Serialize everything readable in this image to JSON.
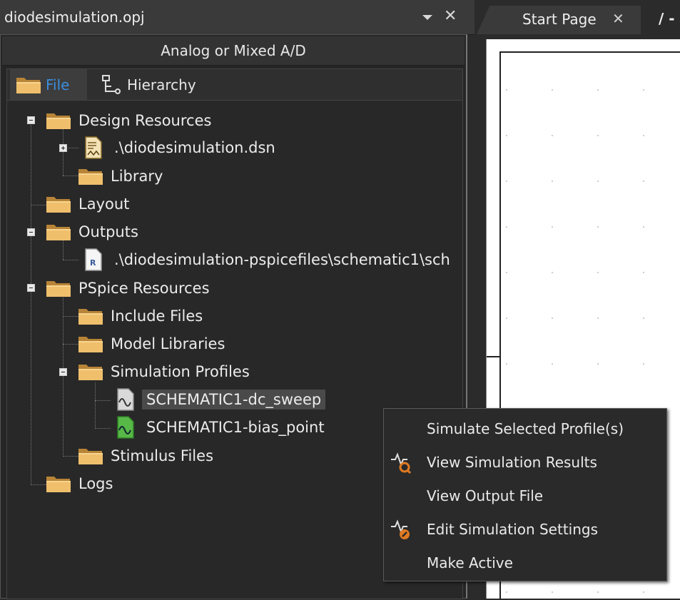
{
  "window": {
    "title": "diodesimulation.opj"
  },
  "panel": {
    "header": "Analog or Mixed A/D",
    "tabs": [
      {
        "label": "File"
      },
      {
        "label": "Hierarchy"
      }
    ]
  },
  "tree": {
    "design_resources": "Design Resources",
    "dsn_file": ".\\diodesimulation.dsn",
    "library": "Library",
    "layout": "Layout",
    "outputs": "Outputs",
    "output_file": ".\\diodesimulation-pspicefiles\\schematic1\\sch",
    "pspice_resources": "PSpice Resources",
    "include_files": "Include Files",
    "model_libraries": "Model Libraries",
    "simulation_profiles": "Simulation Profiles",
    "profile_dc_sweep": "SCHEMATIC1-dc_sweep",
    "profile_bias_point": "SCHEMATIC1-bias_point",
    "stimulus_files": "Stimulus Files",
    "logs": "Logs"
  },
  "editor_tabs": {
    "start_page": "Start Page",
    "other_tab": "/ -"
  },
  "context_menu": {
    "simulate_selected": "Simulate Selected Profile(s)",
    "view_results": "View Simulation Results",
    "view_output": "View Output File",
    "edit_settings": "Edit Simulation Settings",
    "make_active": "Make Active"
  },
  "colors": {
    "accent": "#3c8ddc",
    "folder": "#e8b15a",
    "menu_icon": "#e07a22"
  }
}
